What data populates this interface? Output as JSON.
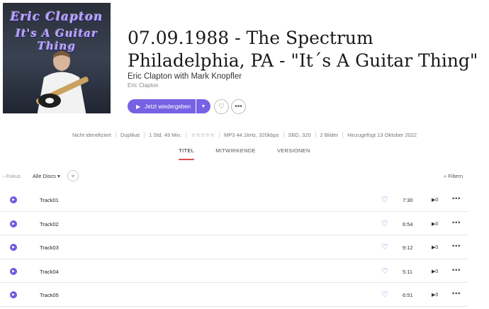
{
  "cover": {
    "line1": "Eric Clapton",
    "line2": "It's A Guitar Thing"
  },
  "album": {
    "title": "07.09.1988 - The Spectrum Philadelphia, PA - \"It´s A Guitar Thing\"",
    "artists": "Eric Clapton with Mark Knopfler",
    "sub_artist": "Eric Clapton"
  },
  "actions": {
    "play_label": "Jetzt wiedergeben",
    "play_icon": "play-icon",
    "caret_icon": "chevron-down-icon",
    "heart_icon": "heart-icon",
    "more_icon": "more-icon"
  },
  "meta": [
    "Nicht identifiziert",
    "Duplikat",
    "1 Std. 49 Min.",
    "☆☆☆☆☆",
    "MP3 44.1kHz, 320kbps",
    "SBD, 320",
    "2 Bilder",
    "Hinzugefügt 13 Oktober 2022"
  ],
  "tabs": [
    {
      "label": "TITEL",
      "active": true
    },
    {
      "label": "MITWIRKENDE",
      "active": false
    },
    {
      "label": "VERSIONEN",
      "active": false
    }
  ],
  "toolbar": {
    "fokus": "Fokus",
    "discs": "Alle Discs",
    "filter": "Filtern"
  },
  "tracks": [
    {
      "name": "Track01",
      "duration": "7:30",
      "plays": "0"
    },
    {
      "name": "Track02",
      "duration": "6:54",
      "plays": "0"
    },
    {
      "name": "Track03",
      "duration": "9:12",
      "plays": "0"
    },
    {
      "name": "Track04",
      "duration": "5:11",
      "plays": "0"
    },
    {
      "name": "Track05",
      "duration": "6:51",
      "plays": "0"
    }
  ],
  "colors": {
    "accent": "#7662e4",
    "tab_underline": "#e14b4b"
  }
}
